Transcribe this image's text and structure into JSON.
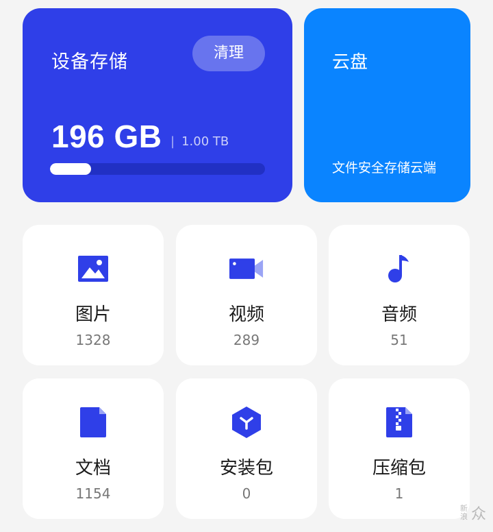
{
  "storage": {
    "title": "设备存储",
    "clean_label": "清理",
    "used": "196 GB",
    "total": "1.00 TB",
    "used_fraction": 0.19
  },
  "cloud": {
    "title": "云盘",
    "subtitle": "文件安全存储云端"
  },
  "categories": [
    {
      "name": "图片",
      "count": "1328",
      "icon": "image-icon"
    },
    {
      "name": "视频",
      "count": "289",
      "icon": "video-icon"
    },
    {
      "name": "音频",
      "count": "51",
      "icon": "music-note-icon"
    },
    {
      "name": "文档",
      "count": "1154",
      "icon": "document-icon"
    },
    {
      "name": "安装包",
      "count": "0",
      "icon": "package-icon"
    },
    {
      "name": "压缩包",
      "count": "1",
      "icon": "zip-file-icon"
    }
  ],
  "watermark": {
    "text": "众",
    "small": "新浪"
  },
  "colors": {
    "storage_card": "#2f3fe8",
    "cloud_card": "#0a84ff",
    "icon": "#2f3fe8"
  }
}
